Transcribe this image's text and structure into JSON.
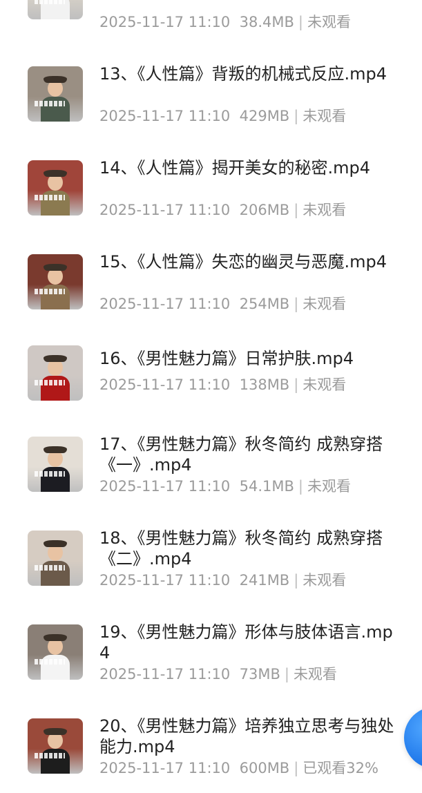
{
  "items": [
    {
      "title": "",
      "date": "2025-11-17 11:10",
      "size": "38.4MB",
      "status": "未观看",
      "thumb_color": "#d8d2c8",
      "shirt_color": "#f2f2f2"
    },
    {
      "title": "13、《人性篇》背叛的机械式反应.mp4",
      "date": "2025-11-17 11:10",
      "size": "429MB",
      "status": "未观看",
      "thumb_color": "#9a8f83",
      "shirt_color": "#4a5a4c"
    },
    {
      "title": "14、《人性篇》揭开美女的秘密.mp4",
      "date": "2025-11-17 11:10",
      "size": "206MB",
      "status": "未观看",
      "thumb_color": "#a0453a",
      "shirt_color": "#8b7a50"
    },
    {
      "title": "15、《人性篇》失恋的幽灵与恶魔.mp4",
      "date": "2025-11-17 11:10",
      "size": "254MB",
      "status": "未观看",
      "thumb_color": "#7a3a2e",
      "shirt_color": "#8a6f4e"
    },
    {
      "title": "16、《男性魅力篇》日常护肤.mp4",
      "date": "2025-11-17 11:10",
      "size": "138MB",
      "status": "未观看",
      "thumb_color": "#cfc8c4",
      "shirt_color": "#b01818"
    },
    {
      "title": "17、《男性魅力篇》秋冬简约 成熟穿搭《一》.mp4",
      "date": "2025-11-17 11:10",
      "size": "54.1MB",
      "status": "未观看",
      "thumb_color": "#e4ded6",
      "shirt_color": "#1c1c22"
    },
    {
      "title": "18、《男性魅力篇》秋冬简约 成熟穿搭《二》.mp4",
      "date": "2025-11-17 11:10",
      "size": "241MB",
      "status": "未观看",
      "thumb_color": "#d6ccc2",
      "shirt_color": "#6b5a4a"
    },
    {
      "title": "19、《男性魅力篇》形体与肢体语言.mp4",
      "date": "2025-11-17 11:10",
      "size": "73MB",
      "status": "未观看",
      "thumb_color": "#8a7f76",
      "shirt_color": "#f4f4f4"
    },
    {
      "title": "20、《男性魅力篇》培养独立思考与独处能力.mp4",
      "date": "2025-11-17 11:10",
      "size": "600MB",
      "status": "已观看32%",
      "thumb_color": "#9a4a3a",
      "shirt_color": "#1d1d1d"
    }
  ]
}
